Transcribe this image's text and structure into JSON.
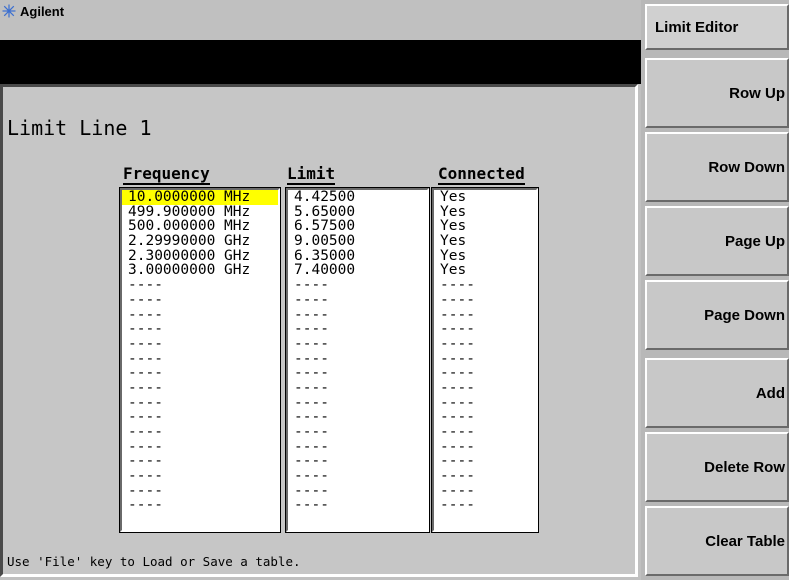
{
  "header": {
    "brand": "Agilent"
  },
  "panel": {
    "title": "Limit Line 1",
    "columns": [
      "Frequency",
      "Limit",
      "Connected"
    ],
    "frequency": [
      "10.0000000 MHz",
      "499.900000 MHz",
      "500.000000 MHz",
      "2.29990000 GHz",
      "2.30000000 GHz",
      "3.00000000 GHz",
      "----",
      "----",
      "----",
      "----",
      "----",
      "----",
      "----",
      "----",
      "----",
      "----",
      "----",
      "----",
      "----",
      "----",
      "----",
      "----"
    ],
    "limit": [
      "4.42500",
      "5.65000",
      "6.57500",
      "9.00500",
      "6.35000",
      "7.40000",
      "----",
      "----",
      "----",
      "----",
      "----",
      "----",
      "----",
      "----",
      "----",
      "----",
      "----",
      "----",
      "----",
      "----",
      "----",
      "----"
    ],
    "connected": [
      "Yes",
      "Yes",
      "Yes",
      "Yes",
      "Yes",
      "Yes",
      "----",
      "----",
      "----",
      "----",
      "----",
      "----",
      "----",
      "----",
      "----",
      "----",
      "----",
      "----",
      "----",
      "----",
      "----",
      "----"
    ],
    "selected_row": 0,
    "selected_color": "#ffff00",
    "footer": "Use 'File' key to Load or Save a table."
  },
  "softkeys": {
    "menu_title": "Limit Editor",
    "keys": [
      "Row Up",
      "Row Down",
      "Page Up",
      "Page Down",
      "Add",
      "Delete Row",
      "Clear Table"
    ]
  }
}
